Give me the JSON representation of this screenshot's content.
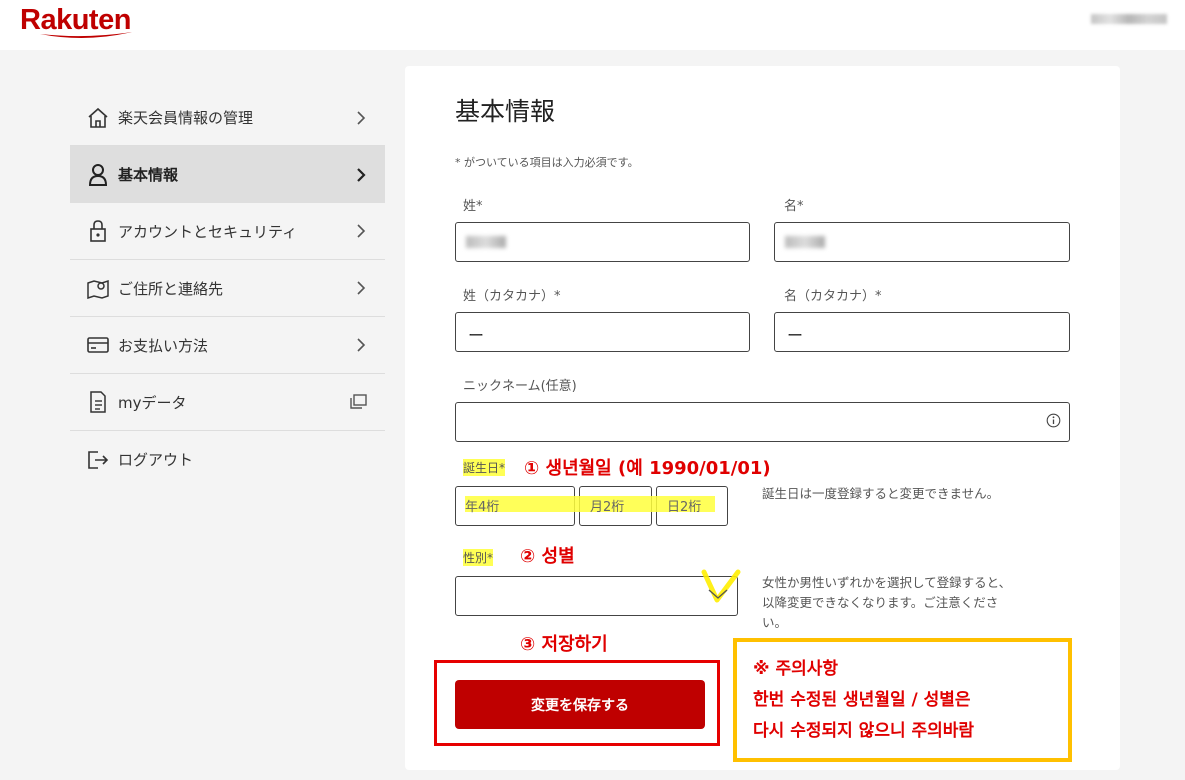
{
  "brand": {
    "name": "Rakuten"
  },
  "sidebar": {
    "items": [
      {
        "label": "楽天会員情報の管理",
        "icon": "home-icon"
      },
      {
        "label": "基本情報",
        "icon": "person-icon",
        "active": true
      },
      {
        "label": "アカウントとセキュリティ",
        "icon": "lock-icon"
      },
      {
        "label": "ご住所と連絡先",
        "icon": "map-pin-icon"
      },
      {
        "label": "お支払い方法",
        "icon": "credit-card-icon"
      },
      {
        "label": "myデータ",
        "icon": "document-icon"
      },
      {
        "label": "ログアウト",
        "icon": "logout-icon"
      }
    ]
  },
  "form": {
    "title": "基本情報",
    "required_note": "* がついている項目は入力必須です。",
    "last_name_label": "姓*",
    "first_name_label": "名*",
    "last_name_kana_label": "姓（カタカナ）*",
    "first_name_kana_label": "名（カタカナ）*",
    "last_name_kana_value": "ー",
    "first_name_kana_value": "ー",
    "nickname_label": "ニックネーム(任意)",
    "birthday_label": "誕生日",
    "birthday_required": "*",
    "birthday_year_placeholder": "年4桁",
    "birthday_month_placeholder": "月2桁",
    "birthday_day_placeholder": "日2桁",
    "birthday_help": "誕生日は一度登録すると変更できません。",
    "gender_label": "性別",
    "gender_required": "*",
    "gender_help_lines": [
      "女性か男性いずれかを選択して登録すると、",
      "以降変更できなくなります。ご注意くださ",
      "い。"
    ],
    "save_label": "変更を保存する"
  },
  "annotations": {
    "step1": "① 생년월일 (예 1990/01/01)",
    "step2": "② 성별",
    "step3": "③ 저장하기",
    "notice_lines": [
      "※ 주의사항",
      "한번 수정된 생년월일 / 성별은",
      "다시 수정되지 않으니 주의바람"
    ]
  },
  "colors": {
    "brand_red": "#bf0000",
    "annotation_red": "#e00000",
    "highlight_yellow": "#ffff55",
    "notice_border": "#ffc000"
  }
}
